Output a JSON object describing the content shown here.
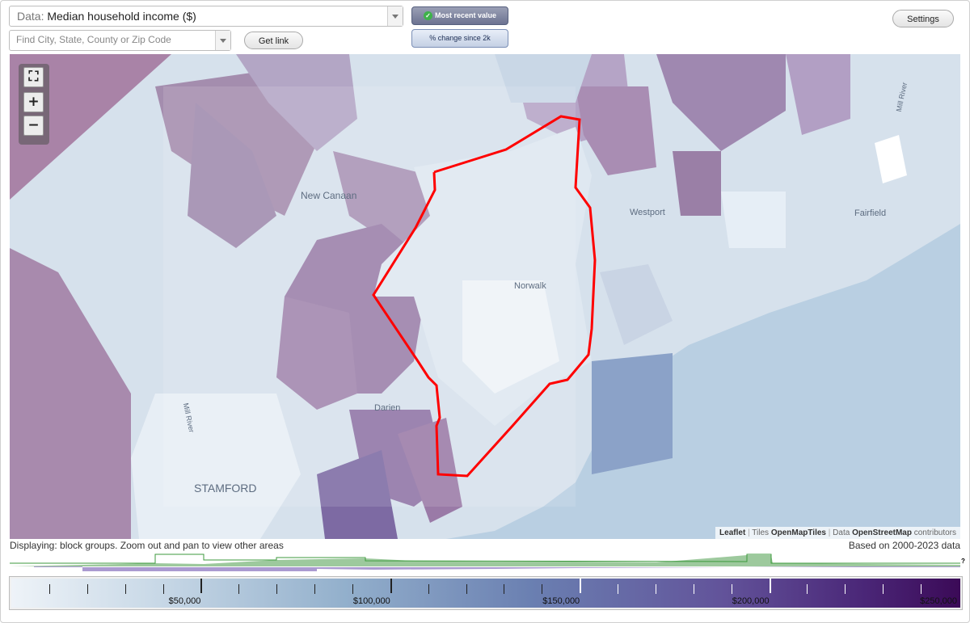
{
  "data_select": {
    "prefix": "Data:",
    "value": "Median household income ($)"
  },
  "search": {
    "placeholder": "Find City, State, County or Zip Code"
  },
  "buttons": {
    "get_link": "Get link",
    "settings": "Settings"
  },
  "toggles": {
    "most_recent": "Most recent value",
    "change": "% change since 2k",
    "active": "most_recent"
  },
  "map": {
    "places": [
      "New Canaan",
      "Westport",
      "Fairfield",
      "Norwalk",
      "Darien",
      "STAMFORD",
      "Mill River",
      "Mill River"
    ],
    "zoom_controls": {
      "full": "⛶",
      "in": "+",
      "out": "−"
    },
    "boundary_color": "#ff0000"
  },
  "attribution": {
    "leaflet": "Leaflet",
    "tiles": "Tiles",
    "tiles_src": "OpenMapTiles",
    "data": "Data",
    "data_src": "OpenStreetMap",
    "contrib": "contributors"
  },
  "status": {
    "displaying": "Displaying: block groups. Zoom out and pan to view other areas",
    "based_on": "Based on 2000-2023 data"
  },
  "legend": {
    "labels": [
      "$50,000",
      "$100,000",
      "$150,000",
      "$200,000",
      "$250,000"
    ],
    "label_values": [
      50000,
      100000,
      150000,
      200000,
      250000
    ],
    "min": 0,
    "max": 250000,
    "colors": [
      "#eef3f8",
      "#c9d9e7",
      "#93b0cc",
      "#6a7fb1",
      "#62539a",
      "#4a2677",
      "#3b0a57"
    ]
  },
  "histogram_mark": "?"
}
